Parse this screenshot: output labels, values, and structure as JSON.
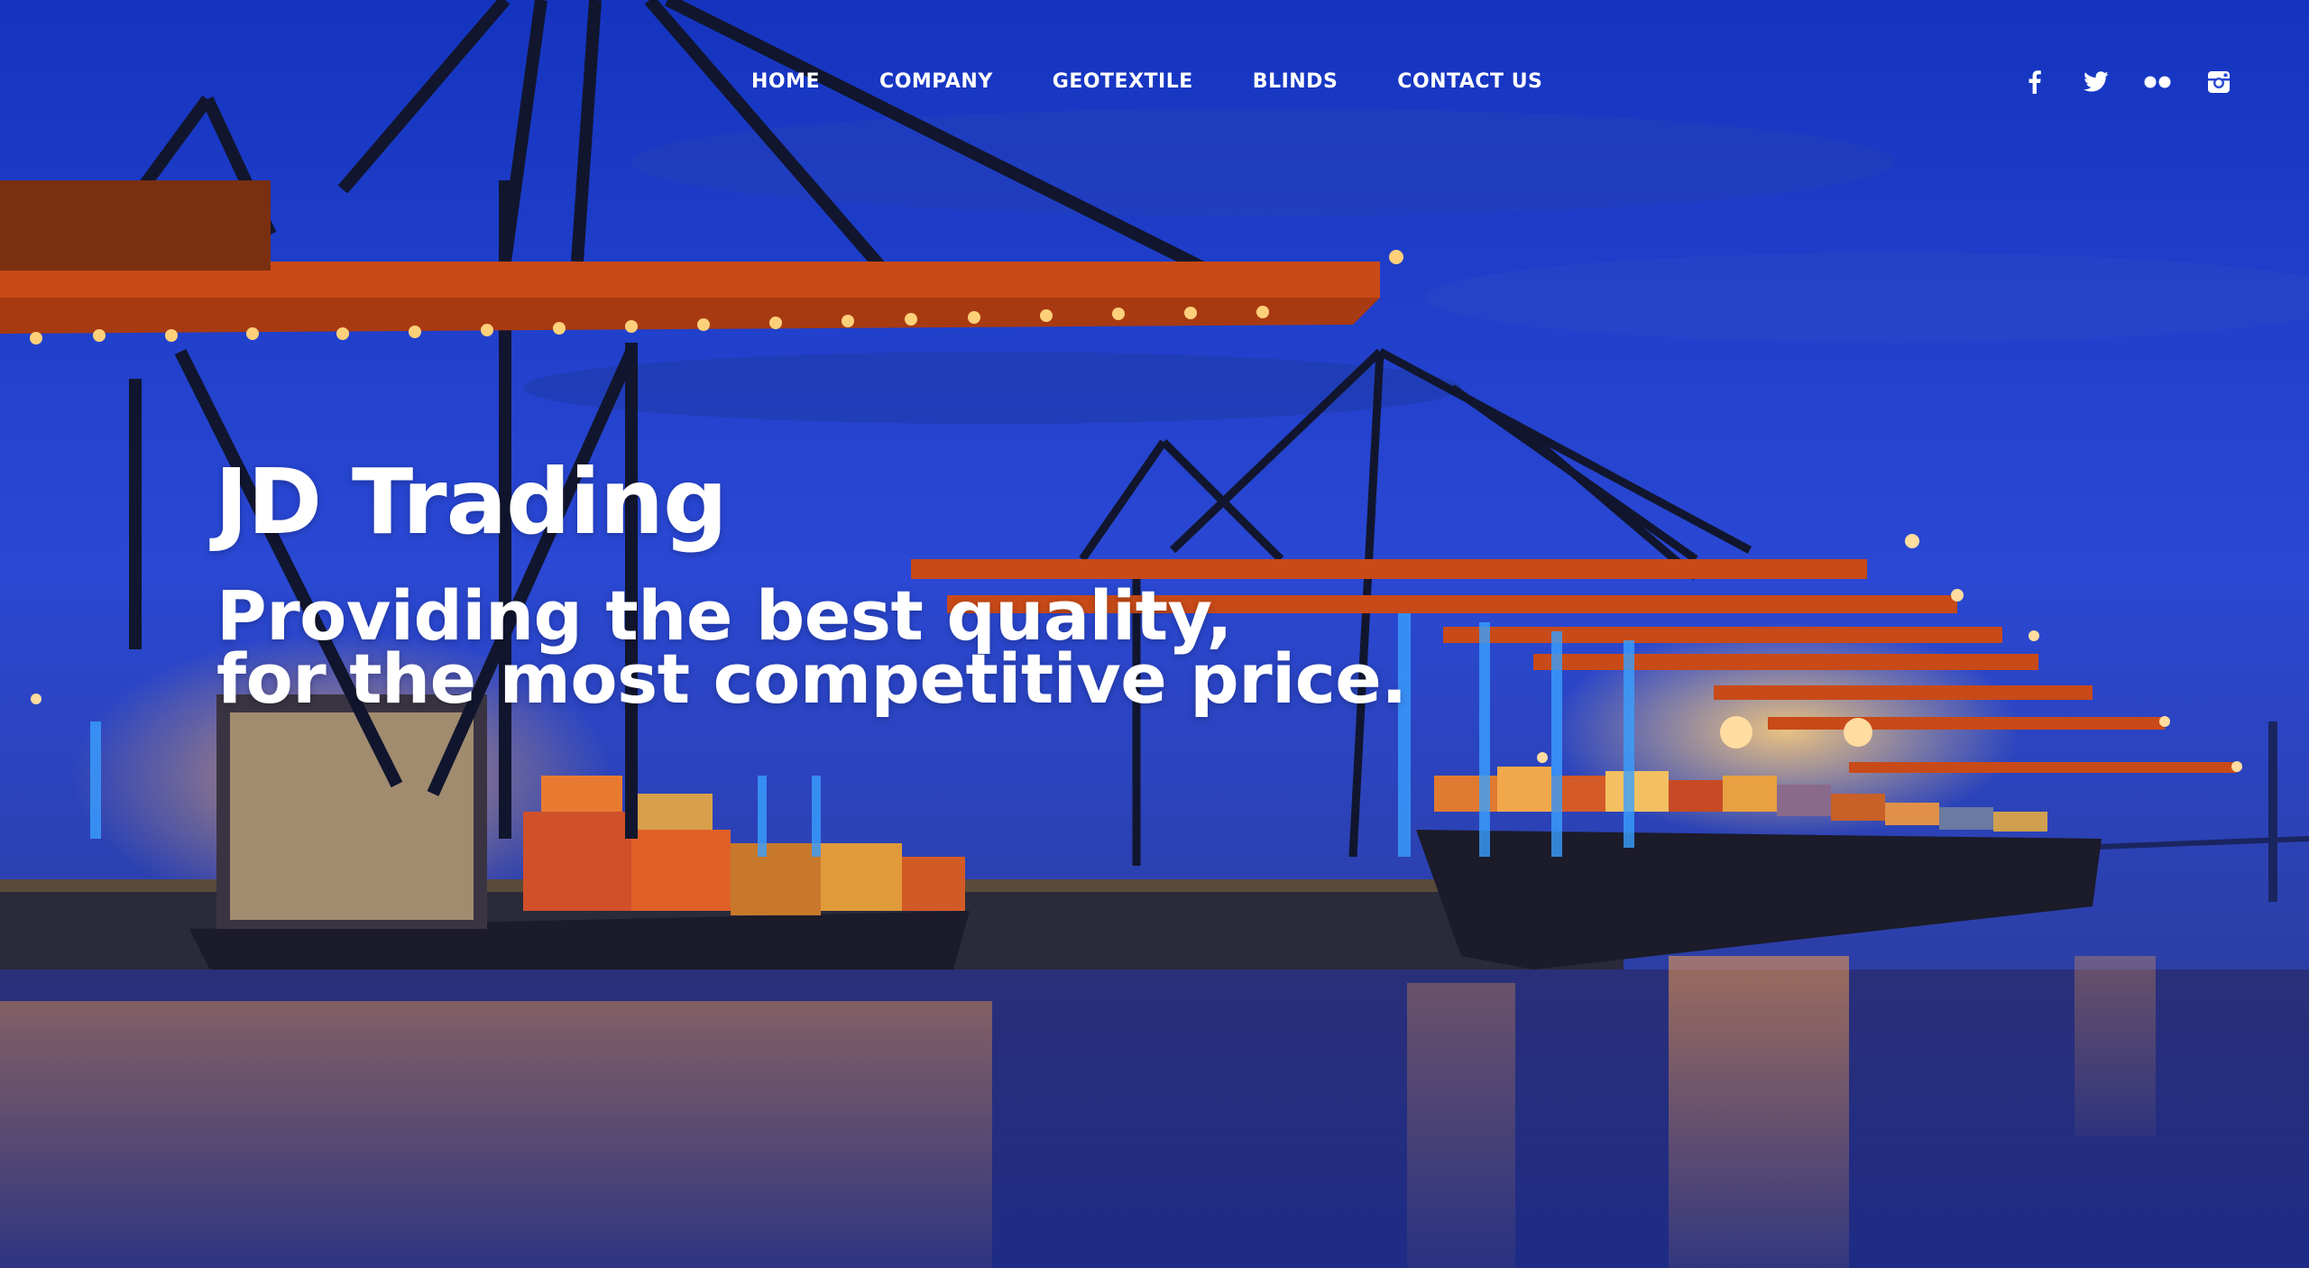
{
  "colors": {
    "sky_top": "#1638c4",
    "sky_mid": "#2a4ad6",
    "water": "#1a2f8a",
    "crane_orange": "#e8671a",
    "light_glow": "#ffb347",
    "text": "#ffffff"
  },
  "nav": {
    "items": [
      {
        "label": "HOME"
      },
      {
        "label": "COMPANY"
      },
      {
        "label": "GEOTEXTILE"
      },
      {
        "label": "BLINDS"
      },
      {
        "label": "CONTACT US"
      }
    ],
    "social": [
      {
        "icon": "facebook-icon"
      },
      {
        "icon": "twitter-icon"
      },
      {
        "icon": "flickr-icon"
      },
      {
        "icon": "instagram-icon"
      }
    ]
  },
  "hero": {
    "title": "JD Trading",
    "tagline_line1": "Providing the best quality,",
    "tagline_line2": "for the most competitive price."
  }
}
